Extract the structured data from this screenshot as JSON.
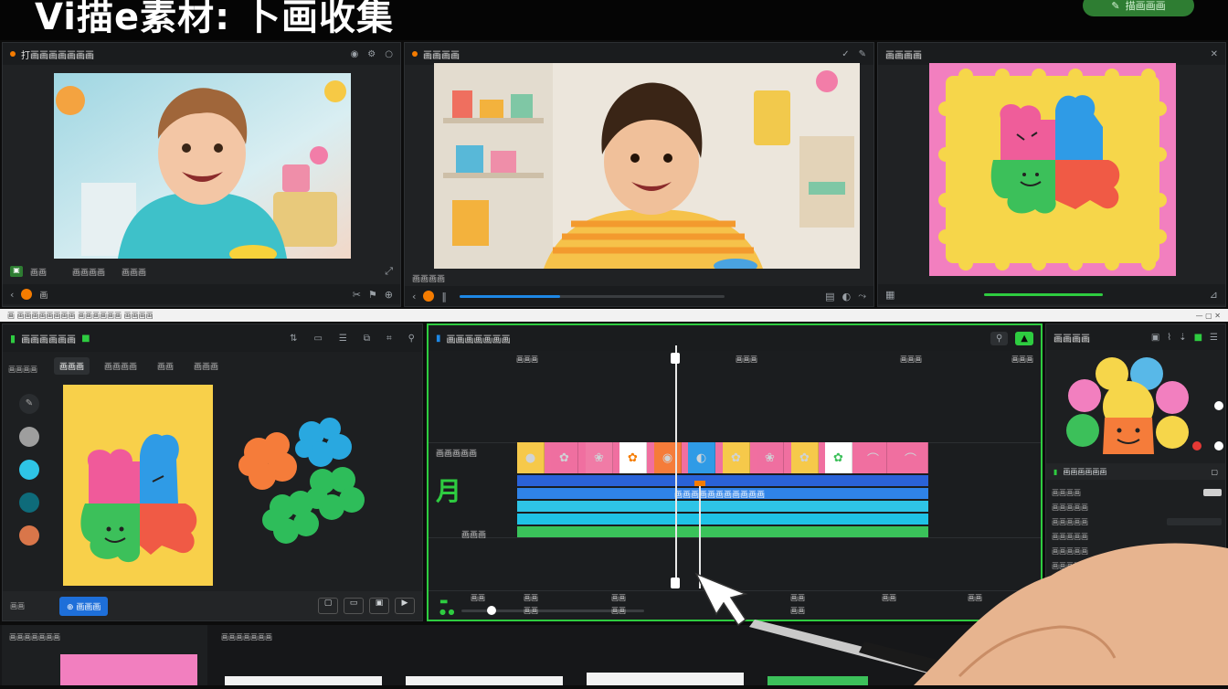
{
  "header": {
    "title": "Vi描e素材: 卜画收集",
    "pill_label": "描画画画"
  },
  "preview1": {
    "title": "打画画画画画画画",
    "bottom_label": "画画",
    "bottom_info": "画画画画",
    "export_label": "画画画",
    "time": "画"
  },
  "preview2": {
    "title": "画画画画",
    "label": "画画画画"
  },
  "preview3": {
    "title": "画画画画"
  },
  "workspace": {
    "breadcrumb": "画 画画画画画画画画 画画画画画画 画画画画"
  },
  "assets": {
    "title": "画画画画画画",
    "side_label": "画画画画",
    "tabs": [
      "画画画",
      "画画画画",
      "画画",
      "画画画"
    ],
    "action_label": "画画画",
    "footer_label": "画画"
  },
  "timeline": {
    "title": "画画画画画画画",
    "ruler": [
      "画画画",
      "画画画",
      "画画画",
      "画画画"
    ],
    "track_labels": [
      "画画画画画",
      "画画画"
    ],
    "center_label": "画画画画画画画画画画画",
    "big_letter": "月",
    "bottom_ticks": [
      "画画",
      "画画",
      "画画",
      "画画",
      "画画",
      "画画",
      "画画",
      "画画",
      "画画"
    ]
  },
  "properties": {
    "title": "画画画画",
    "section_title": "画画画画画画",
    "rows": [
      "画画画画",
      "画画画画画",
      "画画画画画",
      "画画画画画",
      "画画画画画",
      "画画画画画"
    ]
  },
  "bottom": {
    "left_title": "画画画画画画画",
    "right_title": "画画画画画画画"
  },
  "colors": {
    "accent_green": "#2ecc40",
    "accent_orange": "#f57c00",
    "accent_blue": "#1565c0",
    "swatches": [
      "#9e9e9e",
      "#2ec4e6",
      "#0e6b7a",
      "#d9764a"
    ]
  },
  "icons": [
    "play-icon",
    "settings-icon",
    "expand-icon",
    "cursor-icon",
    "scissors-icon",
    "zoom-icon"
  ]
}
